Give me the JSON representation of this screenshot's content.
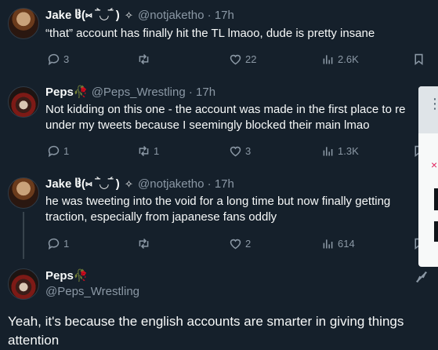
{
  "tweets": [
    {
      "name": "Jake ჱ̒(⑅ ‾̀◡‾́ )",
      "verified_mark": "✧",
      "handle": "@notjaketho",
      "time": "17h",
      "text_lines": [
        "“that” account has finally hit the TL lmaoo, dude is pretty insane"
      ],
      "replies": "3",
      "reposts": "",
      "likes": "22",
      "views": "2.6K"
    },
    {
      "name": "Peps🥀",
      "handle": "@Peps_Wrestling",
      "time": "17h",
      "text_lines": [
        "Not kidding on this one - the account was made in the first place to re",
        "under my tweets because I seemingly blocked their main lmao"
      ],
      "replies": "1",
      "reposts": "1",
      "likes": "3",
      "views": "1.3K"
    },
    {
      "name": "Jake ჱ̒(⑅ ‾̀◡‾́ )",
      "verified_mark": "✧",
      "handle": "@notjaketho",
      "time": "17h",
      "text_lines": [
        "he was tweeting into the void for a long time but now finally getting",
        "traction, especially from japanese fans oddly"
      ],
      "replies": "1",
      "reposts": "",
      "likes": "2",
      "views": "614"
    }
  ],
  "focus_tweet": {
    "name": "Peps🥀",
    "handle": "@Peps_Wrestling",
    "text": "Yeah, it's because the english accounts are smarter in giving things attention"
  },
  "colors": {
    "background": "#15202b",
    "text": "#f7f9f9",
    "muted": "#8b98a5"
  },
  "icons": [
    "reply-icon",
    "repost-icon",
    "like-icon",
    "views-icon",
    "bookmark-icon",
    "grok-icon",
    "more-icon"
  ]
}
